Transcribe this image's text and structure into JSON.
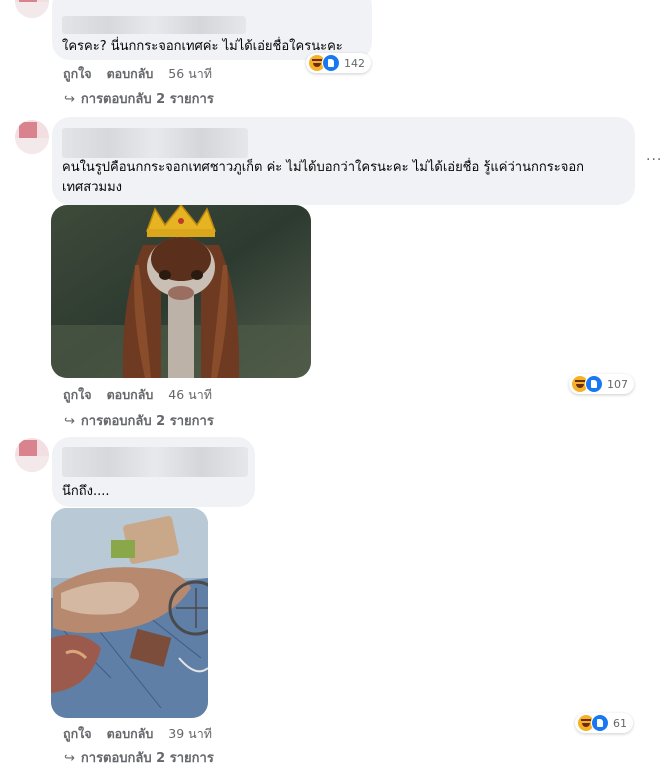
{
  "comments": [
    {
      "text": "ใครคะ? นี่นกกระจอกเทศค่ะ ไม่ได้เอ่ยชื่อใครนะคะ",
      "like": "ถูกใจ",
      "reply": "ตอบกลับ",
      "time": "56 นาที",
      "reaction_count": "142",
      "replies": "การตอบกลับ 2 รายการ"
    },
    {
      "text_line1": "คนในรูปคือนกกระจอกเทศชาวภูเก็ต ค่ะ ไม่ได้บอกว่าใครนะคะ ไม่ได้เอ่ยชื่อ รู้แค่ว่านกกระจอก",
      "text_line2": "เทศสวมมง",
      "like": "ถูกใจ",
      "reply": "ตอบกลับ",
      "time": "46 นาที",
      "reaction_count": "107",
      "replies": "การตอบกลับ 2 รายการ",
      "more": "···"
    },
    {
      "text": "นึกถึง....",
      "like": "ถูกใจ",
      "reply": "ตอบกลับ",
      "time": "39 นาที",
      "reaction_count": "61",
      "replies": "การตอบกลับ 2 รายการ"
    }
  ],
  "icons": {
    "replies_arrow": "↪",
    "reaction_haha": "haha-icon",
    "reaction_like": "like-icon"
  },
  "colors": {
    "bubble": "#f0f2f5",
    "meta": "#65676b",
    "like_blue": "#1877f2",
    "haha_yellow": "#f7b125"
  }
}
